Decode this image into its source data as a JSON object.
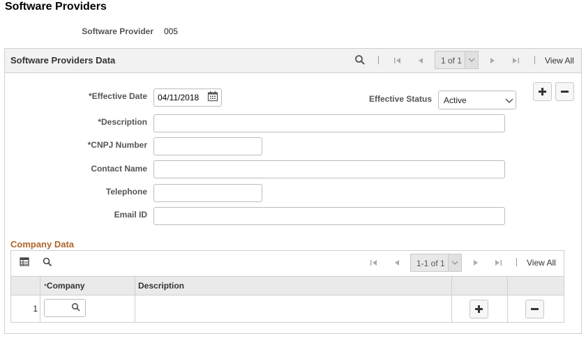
{
  "page": {
    "title": "Software Providers"
  },
  "provider": {
    "label": "Software Provider",
    "value": "005"
  },
  "panel": {
    "title": "Software Providers Data",
    "pager": "1 of 1",
    "view_all": "View All"
  },
  "form": {
    "effective_date": {
      "label": "*Effective Date",
      "value": "04/11/2018"
    },
    "effective_status": {
      "label": "Effective Status",
      "value": "Active"
    },
    "description": {
      "label": "*Description",
      "value": ""
    },
    "cnpj": {
      "label": "*CNPJ Number",
      "value": ""
    },
    "contact_name": {
      "label": "Contact Name",
      "value": ""
    },
    "telephone": {
      "label": "Telephone",
      "value": ""
    },
    "email": {
      "label": "Email ID",
      "value": ""
    }
  },
  "company": {
    "title": "Company Data",
    "pager": "1-1 of 1",
    "view_all": "View All",
    "columns": {
      "required_mark": "*",
      "company": "Company",
      "description": "Description"
    },
    "rows": [
      {
        "num": "1",
        "company": "",
        "description": ""
      }
    ]
  },
  "icons": {
    "search": "search-icon",
    "first": "first-page-icon",
    "prev": "previous-icon",
    "next": "next-icon",
    "last": "last-page-icon",
    "calendar": "calendar-icon",
    "add": "plus-icon",
    "delete": "minus-icon",
    "grid": "grid-personalize-icon"
  },
  "colors": {
    "section_title": "#b0652a",
    "panel_header": "#f2f2f2",
    "grid_header": "#eaeaea"
  }
}
